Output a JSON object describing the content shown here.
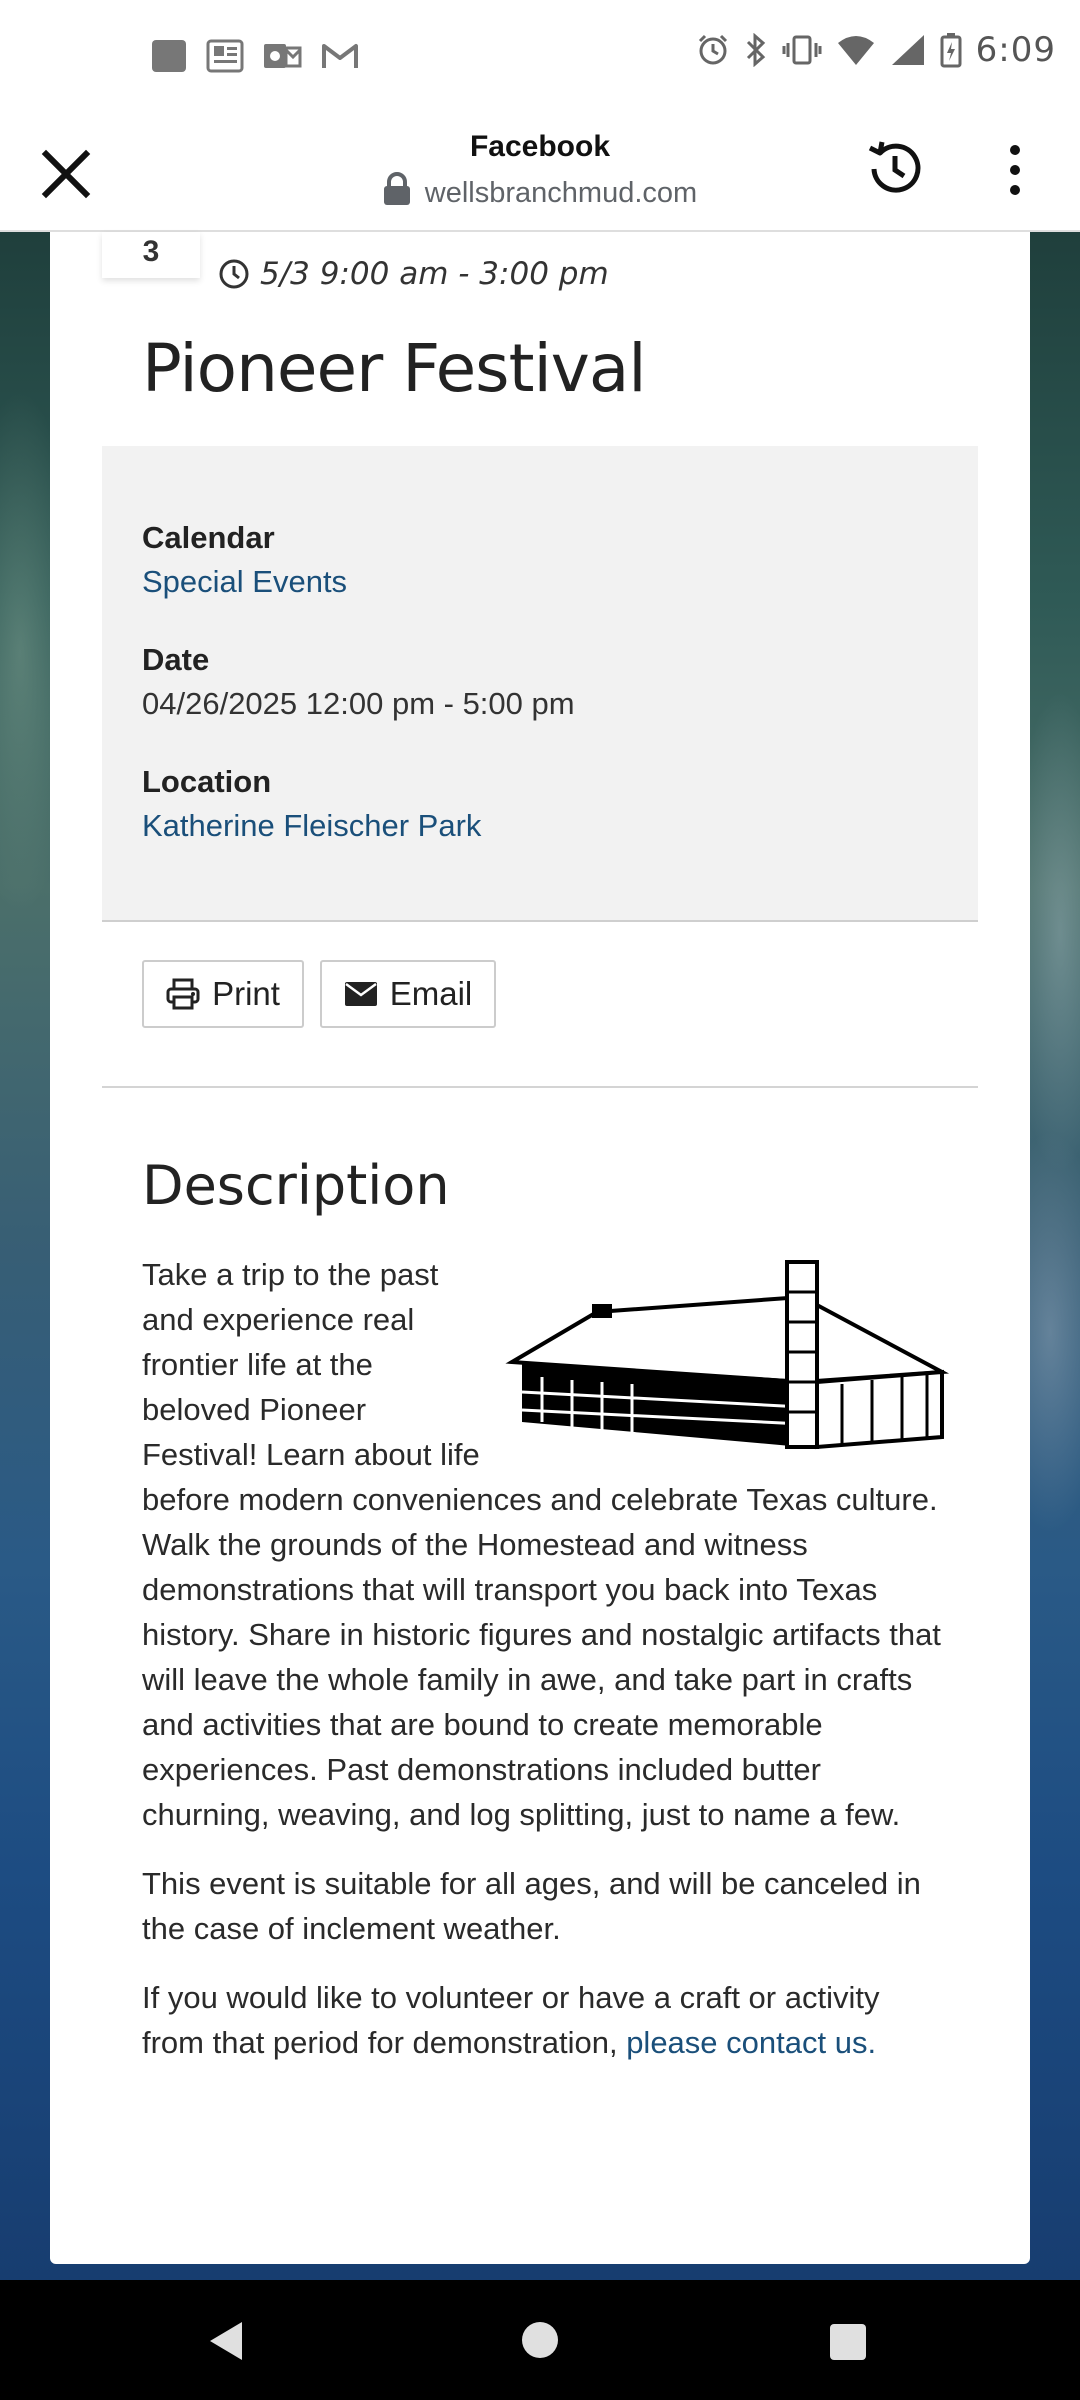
{
  "status_bar": {
    "time": "6:09",
    "left_icons": [
      "app-icon",
      "news-icon",
      "outlook-icon",
      "gmail-icon"
    ],
    "right_icons": [
      "alarm-icon",
      "bluetooth-icon",
      "vibrate-icon",
      "wifi-icon",
      "signal-icon",
      "battery-icon"
    ]
  },
  "browser": {
    "title": "Facebook",
    "url": "wellsbranchmud.com"
  },
  "event": {
    "badge_day": "3",
    "time_range": "5/3 9:00 am - 3:00 pm",
    "title": "Pioneer Festival"
  },
  "info": {
    "calendar_label": "Calendar",
    "calendar_value": "Special Events",
    "date_label": "Date",
    "date_value": "04/26/2025 12:00 pm - 5:00 pm",
    "location_label": "Location",
    "location_value": "Katherine Fleischer Park"
  },
  "actions": {
    "print_label": "Print",
    "email_label": "Email"
  },
  "description": {
    "heading": "Description",
    "paragraph1": "Take a trip to the past and experience real frontier life at the beloved Pioneer Festival! Learn about life before modern conveniences and celebrate Texas culture. Walk the grounds of the Homestead and witness demonstrations that will transport you back into Texas history. Share in historic figures and nostalgic artifacts that will leave the whole family in awe, and take part in crafts and activities that are bound to create memorable experiences. Past demonstrations included butter churning, weaving, and log splitting, just to name a few.",
    "paragraph2": "This event is suitable for all ages, and will be canceled in the case of inclement weather.",
    "paragraph3_text": "If you would like to volunteer or have a craft or activity from that period for demonstration, ",
    "paragraph3_link": "please contact us."
  },
  "colors": {
    "link": "#1a4f7a",
    "info_box_bg": "#f2f2f2",
    "nav_bar_bg": "#000000"
  }
}
